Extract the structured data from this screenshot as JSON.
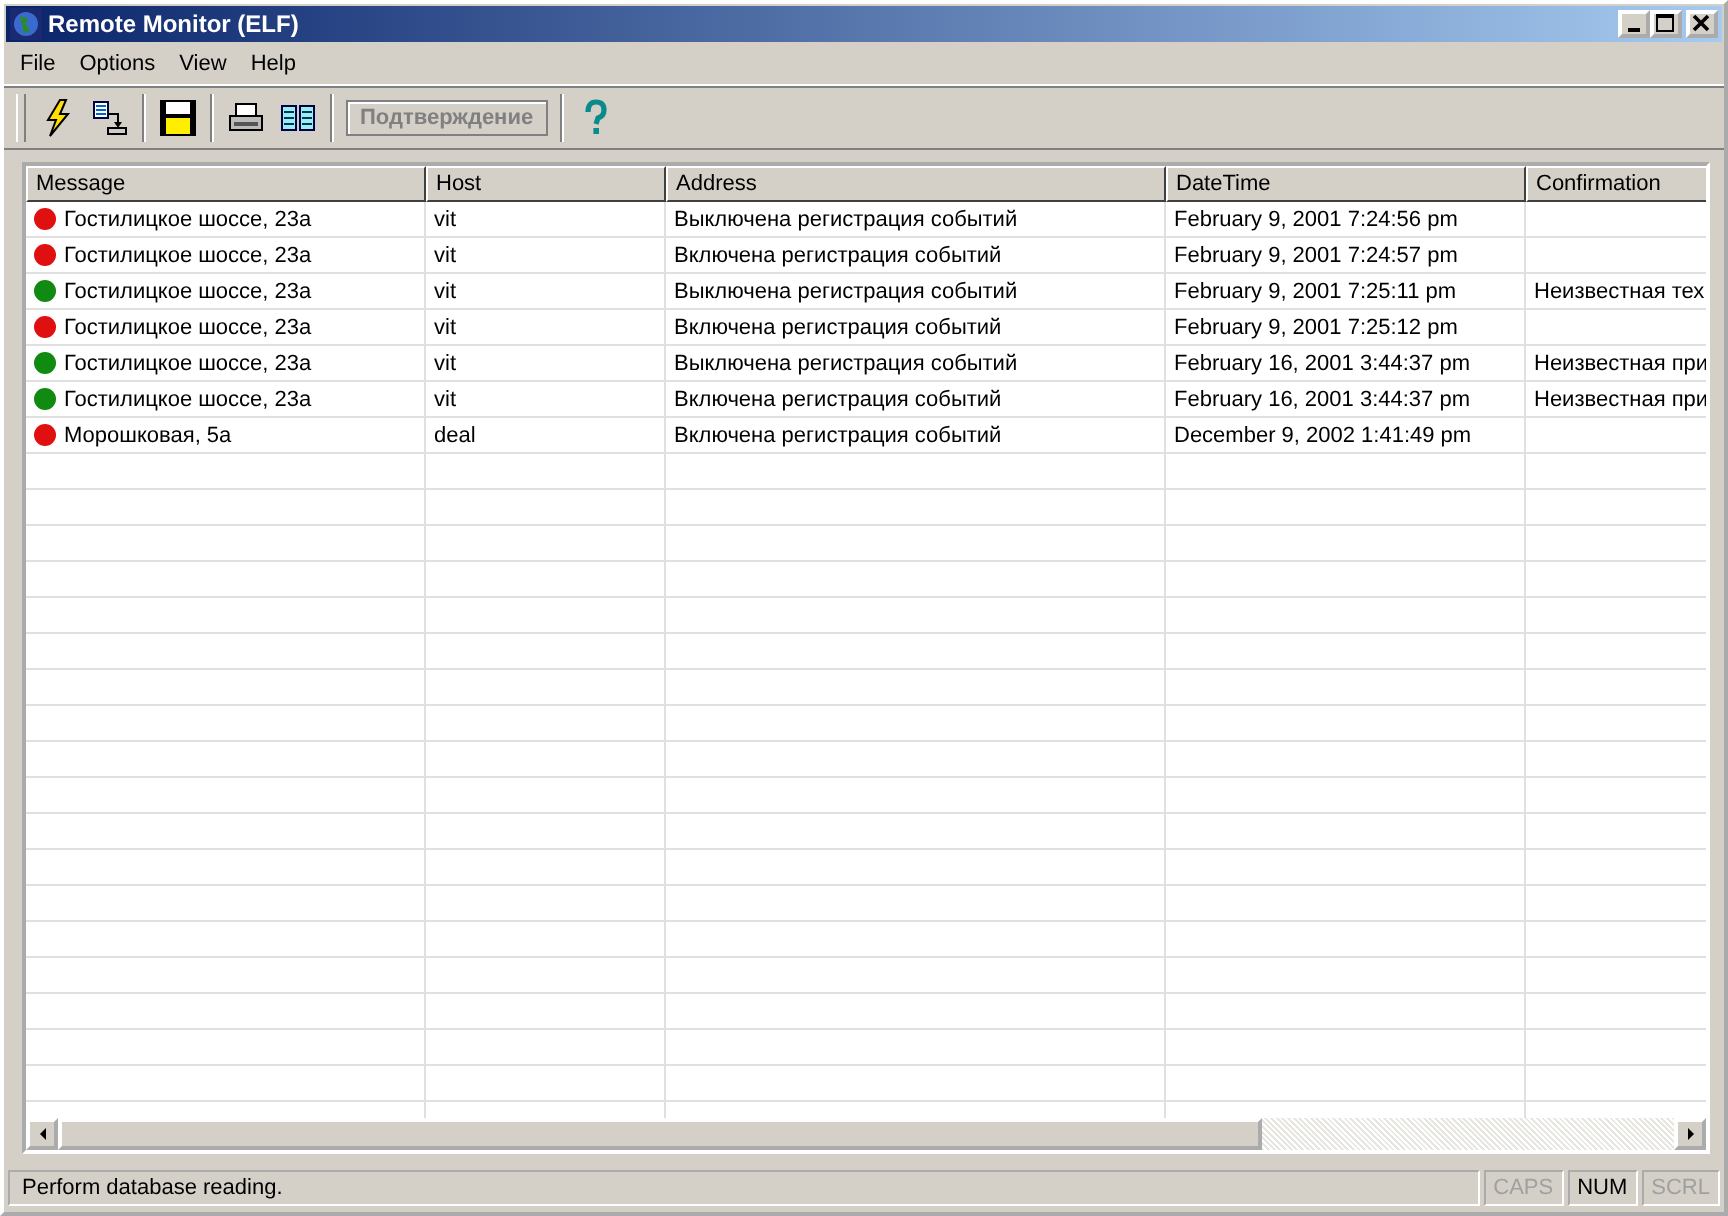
{
  "window": {
    "title": "Remote Monitor (ELF)"
  },
  "menu": [
    "File",
    "Options",
    "View",
    "Help"
  ],
  "toolbar": {
    "confirm_button": {
      "label": "Подтверждение",
      "disabled": true
    }
  },
  "table": {
    "columns": [
      "Message",
      "Host",
      "Address",
      "DateTime",
      "Confirmation"
    ],
    "rows": [
      {
        "color": "#e01010",
        "cells": [
          "Гостилицкое шоссе, 23а",
          "vit",
          "Выключена регистрация событий",
          "February 9, 2001 7:24:56 pm",
          ""
        ]
      },
      {
        "color": "#e01010",
        "cells": [
          "Гостилицкое шоссе, 23а",
          "vit",
          "Включена регистрация событий",
          "February 9, 2001 7:24:57 pm",
          ""
        ]
      },
      {
        "color": "#108a10",
        "cells": [
          "Гостилицкое шоссе, 23а",
          "vit",
          "Выключена регистрация событий",
          "February 9, 2001 7:25:11 pm",
          "Неизвестная тех"
        ]
      },
      {
        "color": "#e01010",
        "cells": [
          "Гостилицкое шоссе, 23а",
          "vit",
          "Включена регистрация событий",
          "February 9, 2001 7:25:12 pm",
          ""
        ]
      },
      {
        "color": "#108a10",
        "cells": [
          "Гостилицкое шоссе, 23а",
          "vit",
          "Выключена регистрация событий",
          "February 16, 2001 3:44:37 pm",
          "Неизвестная при"
        ]
      },
      {
        "color": "#108a10",
        "cells": [
          "Гостилицкое шоссе, 23а",
          "vit",
          "Включена регистрация событий",
          "February 16, 2001 3:44:37 pm",
          "Неизвестная при"
        ]
      },
      {
        "color": "#e01010",
        "cells": [
          "Морошковая, 5а",
          "deal",
          "Включена регистрация событий",
          "December 9, 2002 1:41:49 pm",
          ""
        ]
      }
    ]
  },
  "status_bar": {
    "message": "Perform database reading.",
    "indicators": [
      {
        "label": "CAPS",
        "on": false
      },
      {
        "label": "NUM",
        "on": true
      },
      {
        "label": "SCRL",
        "on": false
      }
    ]
  }
}
